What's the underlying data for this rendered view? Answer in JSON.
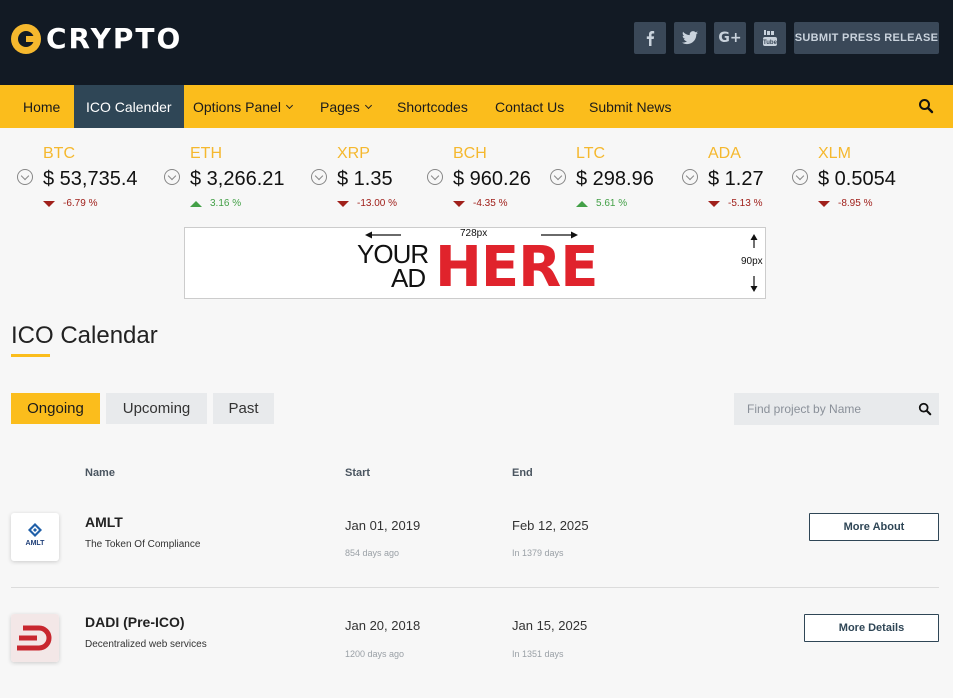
{
  "header": {
    "logo_text": "CRYPTO",
    "social": [
      {
        "icon": "facebook-icon",
        "glyph": "f"
      },
      {
        "icon": "twitter-icon",
        "glyph": "🐦"
      },
      {
        "icon": "google-plus-icon",
        "glyph": "G+"
      },
      {
        "icon": "youtube-icon",
        "glyph": "You Tube"
      }
    ],
    "submit_label": "SUBMIT PRESS RELEASE"
  },
  "nav": {
    "items": [
      {
        "label": "Home"
      },
      {
        "label": "ICO Calender"
      },
      {
        "label": "Options Panel"
      },
      {
        "label": "Pages"
      },
      {
        "label": "Shortcodes"
      },
      {
        "label": "Contact Us"
      },
      {
        "label": "Submit News"
      }
    ],
    "active_index": 1
  },
  "ticker": [
    {
      "symbol": "BTC",
      "price": "$ 53,735.4",
      "change": "-6.79 %",
      "direction": "down"
    },
    {
      "symbol": "ETH",
      "price": "$ 3,266.21",
      "change": "3.16 %",
      "direction": "up"
    },
    {
      "symbol": "XRP",
      "price": "$ 1.35",
      "change": "-13.00 %",
      "direction": "down"
    },
    {
      "symbol": "BCH",
      "price": "$ 960.26",
      "change": "-4.35 %",
      "direction": "down"
    },
    {
      "symbol": "LTC",
      "price": "$ 298.96",
      "change": "5.61 %",
      "direction": "up"
    },
    {
      "symbol": "ADA",
      "price": "$ 1.27",
      "change": "-5.13 %",
      "direction": "down"
    },
    {
      "symbol": "XLM",
      "price": "$ 0.5054",
      "change": "-8.95 %",
      "direction": "down"
    }
  ],
  "ad": {
    "width_label": "728px",
    "height_label": "90px",
    "your": "YOUR",
    "ad": "AD",
    "here": "HERE"
  },
  "section": {
    "title": "ICO Calendar",
    "tabs": [
      "Ongoing",
      "Upcoming",
      "Past"
    ],
    "active_tab": 0,
    "search_placeholder": "Find project by Name"
  },
  "table": {
    "headers": {
      "name": "Name",
      "start": "Start",
      "end": "End"
    },
    "rows": [
      {
        "logo_text": "AMLT",
        "name": "AMLT",
        "subtitle": "The Token Of Compliance",
        "start": "Jan 01, 2019",
        "start_ago": "854 days ago",
        "end": "Feb 12, 2025",
        "end_in": "In 1379 days",
        "button": "More About"
      },
      {
        "logo_text": "",
        "name": "DADI (Pre-ICO)",
        "subtitle": "Decentralized web services",
        "start": "Jan 20, 2018",
        "start_ago": "1200 days ago",
        "end": "Jan 15, 2025",
        "end_in": "In 1351 days",
        "button": "More Details"
      }
    ]
  },
  "colors": {
    "accent": "#fbbd1c",
    "header_bg": "#121a24",
    "nav_active": "#2f4656",
    "negative": "#a0201b",
    "positive": "#43a047"
  }
}
